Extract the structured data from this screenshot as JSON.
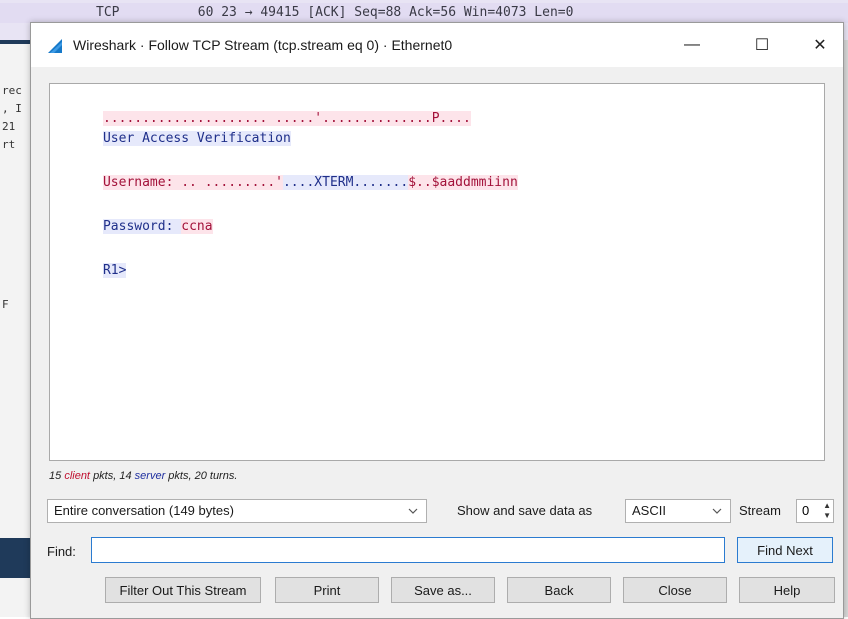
{
  "background": {
    "packet_text": "TCP          60 23 → 49415 [ACK] Seq=88 Ack=56 Win=4073 Len=0",
    "left_fragments": [
      "rec",
      ", I",
      "21",
      "rt",
      "F"
    ]
  },
  "window": {
    "title": "Wireshark · Follow TCP Stream (tcp.stream eq 0) · Ethernet0",
    "minimize": "—",
    "maximize": "☐",
    "close": "✕"
  },
  "stream": {
    "lines": [
      [
        {
          "text": "..................... .....'",
          "who": "client"
        },
        {
          "text": "..............P....",
          "who": "client"
        }
      ],
      [
        {
          "text": "User Access Verification",
          "who": "server"
        }
      ],
      [
        {
          "text": "Username: .. .........'",
          "who": "client"
        },
        {
          "text": "....XTERM.......",
          "who": "server"
        },
        {
          "text": "$..$aaddmmiinn",
          "who": "client"
        }
      ],
      [
        {
          "text": "Password: ",
          "who": "server"
        },
        {
          "text": "ccna",
          "who": "client"
        }
      ],
      [
        {
          "text": "R1>",
          "who": "server"
        }
      ]
    ]
  },
  "summary": {
    "client_count": "15",
    "client_label": "client",
    "client_rest": "pkts,",
    "server_count": "14",
    "server_label": "server",
    "server_rest": "pkts,",
    "turns": "20 turns."
  },
  "controls": {
    "conversation_select": "Entire conversation (149 bytes)",
    "show_label": "Show and save data as",
    "format_select": "ASCII",
    "stream_label": "Stream",
    "stream_value": "0",
    "find_label": "Find:",
    "find_value": "",
    "find_next": "Find Next"
  },
  "buttons": {
    "filter_out": "Filter Out This Stream",
    "print": "Print",
    "save_as": "Save as...",
    "back": "Back",
    "close": "Close",
    "help": "Help"
  },
  "colors": {
    "client_text": "#a3123a",
    "client_bg": "#fde4ea",
    "server_text": "#1f2f8a",
    "server_bg": "#e6e9fb",
    "focus_accent": "#2b7bd0"
  },
  "icons": {
    "app": "wireshark-fin-icon",
    "dropdown": "chevron-down-icon",
    "spinner": "spin-arrows-icon"
  }
}
